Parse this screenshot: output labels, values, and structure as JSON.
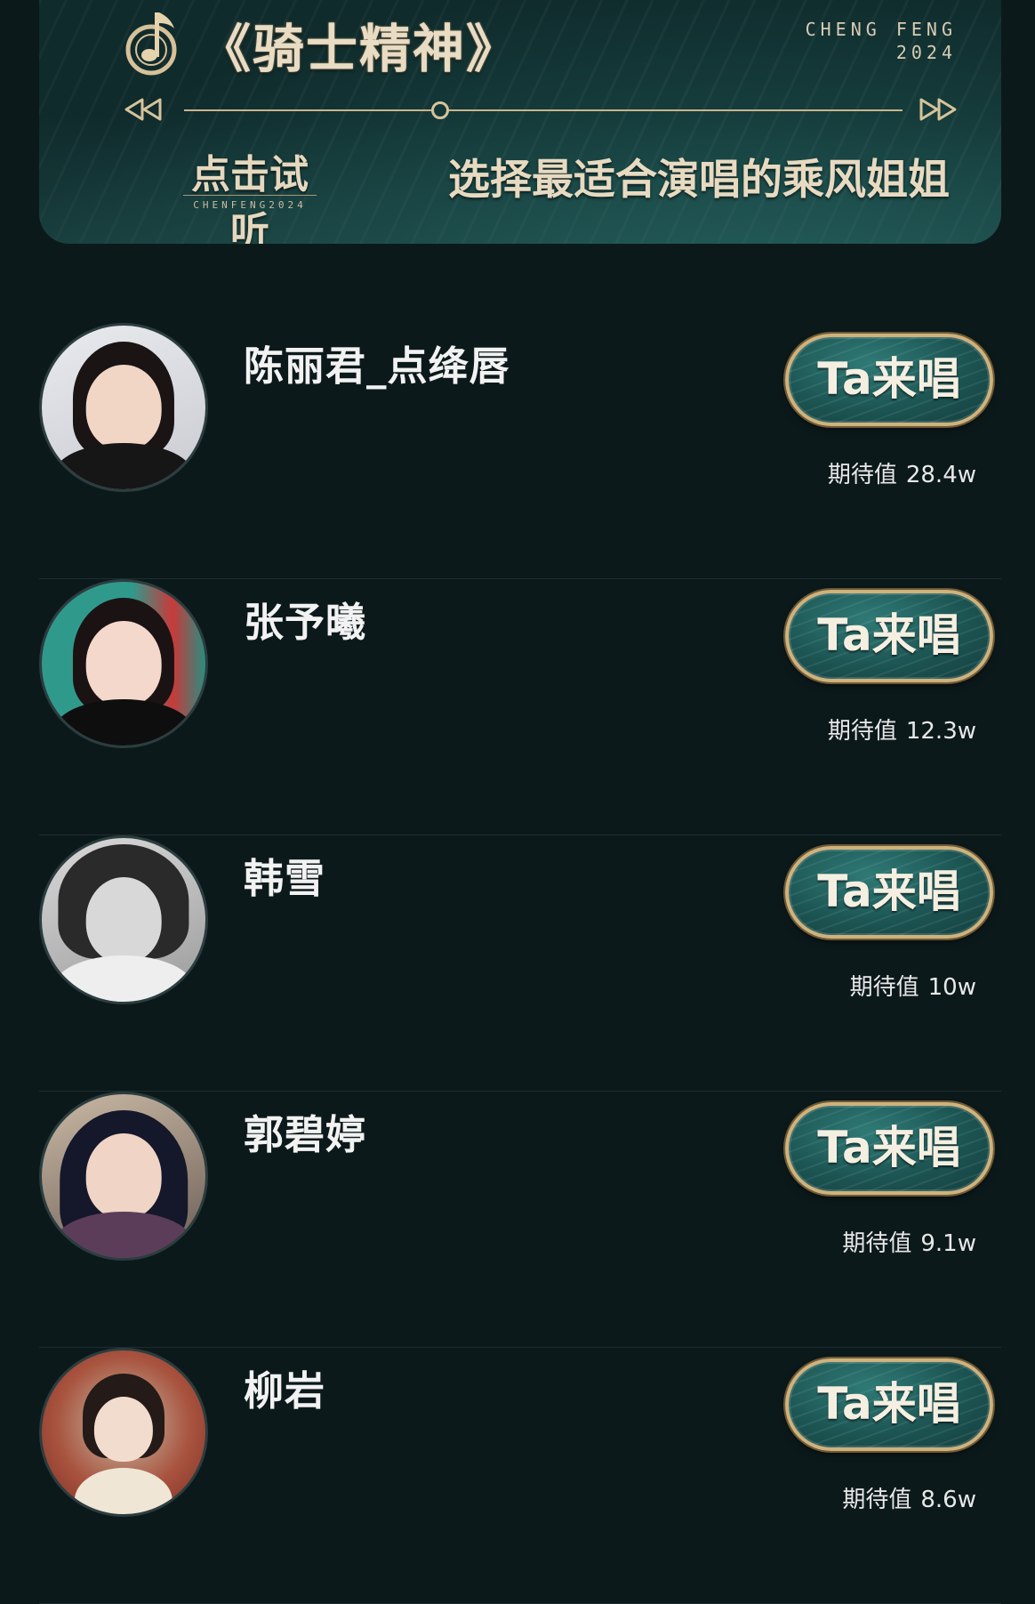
{
  "banner": {
    "song_title": "《骑士精神》",
    "brand_line1": "CHENG FENG",
    "brand_line2": "2024",
    "listen_label": "点击试听",
    "listen_sub": "CHENFENG2024",
    "subtitle": "选择最适合演唱的乘风姐姐",
    "accent_color": "#d7c39a"
  },
  "candidates": [
    {
      "name": "陈丽君_点绛唇",
      "button_label": "Ta来唱",
      "expect_label": "期待值",
      "expect_value": "28.4w"
    },
    {
      "name": "张予曦",
      "button_label": "Ta来唱",
      "expect_label": "期待值",
      "expect_value": "12.3w"
    },
    {
      "name": "韩雪",
      "button_label": "Ta来唱",
      "expect_label": "期待值",
      "expect_value": "10w"
    },
    {
      "name": "郭碧婷",
      "button_label": "Ta来唱",
      "expect_label": "期待值",
      "expect_value": "9.1w"
    },
    {
      "name": "柳岩",
      "button_label": "Ta来唱",
      "expect_label": "期待值",
      "expect_value": "8.6w"
    }
  ],
  "colors": {
    "background": "#0c191b",
    "button_border": "#cfb27c",
    "button_fill": "#1c5553"
  }
}
